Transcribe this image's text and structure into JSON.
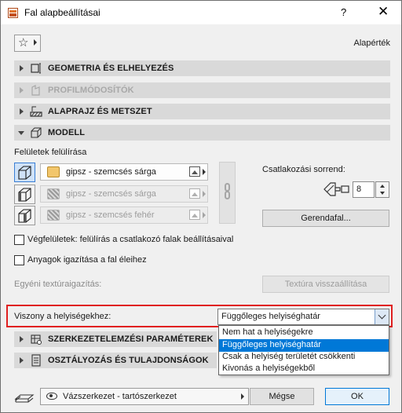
{
  "window": {
    "title": "Fal alapbeállításai",
    "help_glyph": "?",
    "close_glyph": "✕"
  },
  "toolbar": {
    "favorites_glyph": "☆",
    "defaults_label": "Alapérték"
  },
  "sections": {
    "geometry": "GEOMETRIA ÉS ELHELYEZÉS",
    "profile": "PROFILMÓDOSÍTÓK",
    "floorplan": "ALAPRAJZ ÉS METSZET",
    "model": "MODELL",
    "structural": "SZERKEZETELEMZÉSI PARAMÉTEREK",
    "classification": "OSZTÁLYOZÁS ÉS TULAJDONSÁGOK"
  },
  "model": {
    "override_label": "Felületek felülírása",
    "surfaces": [
      {
        "name": "gipsz - szemcsés sárga",
        "enabled": true,
        "color": "#f2c66b"
      },
      {
        "name": "gipsz - szemcsés sárga",
        "enabled": false
      },
      {
        "name": "gipsz - szemcsés fehér",
        "enabled": false
      }
    ],
    "connection_order_label": "Csatlakozási sorrend:",
    "connection_order_value": "8",
    "beam_wall_button": "Gerendafal...",
    "end_surfaces_checkbox": "Végfelületek: felülírás a csatlakozó falak beállításaival",
    "align_materials_checkbox": "Anyagok igazítása a fal éleihez",
    "custom_texture_label": "Egyéni textúraigazítás:",
    "reset_texture_button": "Textúra visszaállítása"
  },
  "zone_relation": {
    "label": "Viszony a helyiségekhez:",
    "selected": "Függőleges helyiséghatár",
    "options": [
      "Nem hat a helyiségekre",
      "Függőleges helyiséghatár",
      "Csak a helyiség területét csökkenti",
      "Kivonás a helyiségekből"
    ],
    "selected_index": 1
  },
  "footer": {
    "layer": "Vázszerkezet - tartószerkezet",
    "cancel": "Mégse",
    "ok": "OK"
  },
  "colors": {
    "highlight": "#e02020",
    "selection": "#0078d7"
  }
}
